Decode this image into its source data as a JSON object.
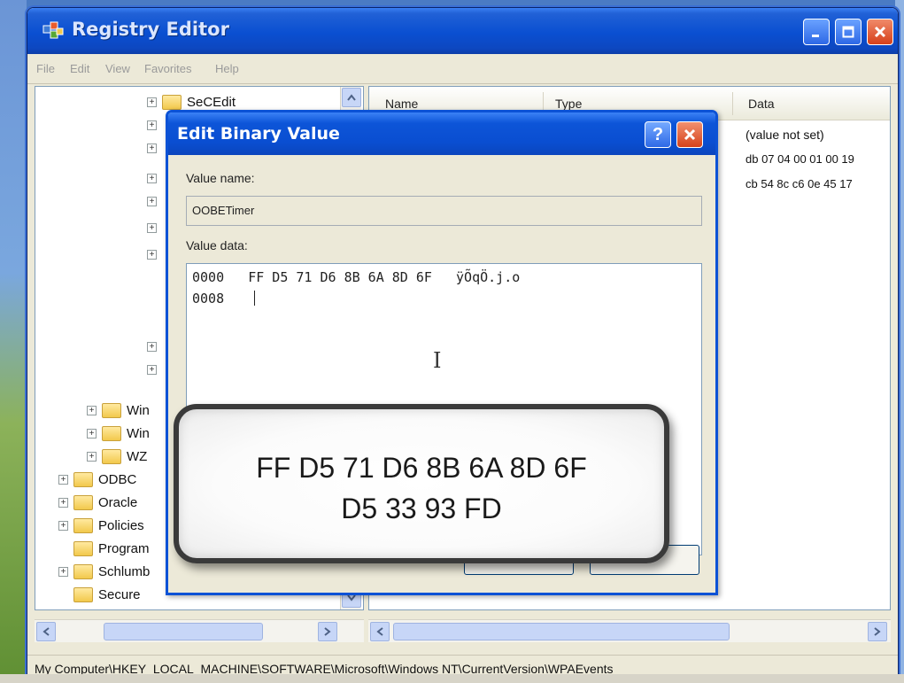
{
  "window": {
    "title": "Registry Editor",
    "menu": [
      "File",
      "Edit",
      "View",
      "Favorites",
      "Help"
    ]
  },
  "tree": {
    "items": [
      {
        "label": "SeCEdit",
        "expander": "+"
      },
      {
        "label": "",
        "expander": "+"
      },
      {
        "label": "",
        "expander": "+"
      },
      {
        "label": "",
        "expander": "+"
      },
      {
        "label": "",
        "expander": "+"
      },
      {
        "label": "",
        "expander": "+"
      },
      {
        "label": "",
        "expander": "+"
      },
      {
        "label": "",
        "expander": "+"
      },
      {
        "label": "",
        "expander": "+"
      },
      {
        "label": "Win",
        "expander": "+"
      },
      {
        "label": "Win",
        "expander": "+"
      },
      {
        "label": "WZ",
        "expander": "+"
      },
      {
        "label": "ODBC",
        "expander": "+"
      },
      {
        "label": "Oracle",
        "expander": "+"
      },
      {
        "label": "Policies",
        "expander": "+"
      },
      {
        "label": "Program",
        "expander": ""
      },
      {
        "label": "Schlumb",
        "expander": "+"
      },
      {
        "label": "Secure",
        "expander": ""
      }
    ]
  },
  "list": {
    "columns": [
      "Name",
      "Type",
      "Data"
    ],
    "data_values": [
      "(value not set)",
      "db 07 04 00 01 00 19",
      "cb 54 8c c6 0e 45 17"
    ]
  },
  "statusbar": {
    "path": "My Computer\\HKEY_LOCAL_MACHINE\\SOFTWARE\\Microsoft\\Windows NT\\CurrentVersion\\WPAEvents"
  },
  "dialog": {
    "title": "Edit Binary Value",
    "help_glyph": "?",
    "value_name_label": "Value name:",
    "value_name": "OOBETimer",
    "value_data_label": "Value data:",
    "hex_lines": [
      "0000   FF D5 71 D6 8B 6A 8D 6F   ÿÕqÖ.j.o",
      "0008 "
    ]
  },
  "callout": {
    "line1": "FF D5 71 D6 8B 6A 8D 6F",
    "line2": "D5 33 93 FD"
  }
}
